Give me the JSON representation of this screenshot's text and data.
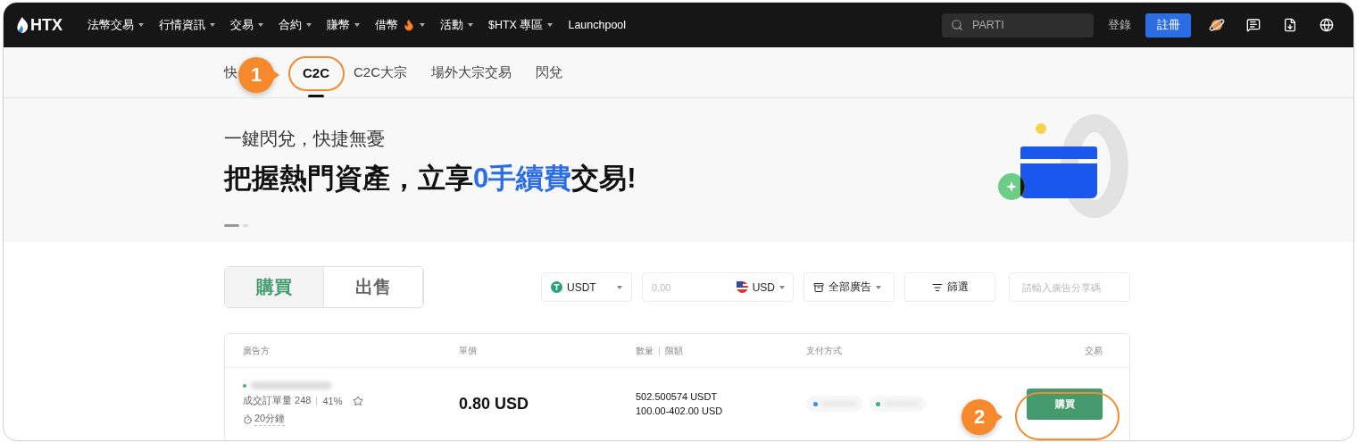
{
  "nav": {
    "logo": "HTX",
    "menu": [
      {
        "label": "法幣交易",
        "dropdown": true,
        "hot": false
      },
      {
        "label": "行情資訊",
        "dropdown": true,
        "hot": false
      },
      {
        "label": "交易",
        "dropdown": true,
        "hot": false
      },
      {
        "label": "合約",
        "dropdown": true,
        "hot": false
      },
      {
        "label": "賺幣",
        "dropdown": true,
        "hot": false
      },
      {
        "label": "借幣",
        "dropdown": true,
        "hot": true
      },
      {
        "label": "活動",
        "dropdown": true,
        "hot": false
      },
      {
        "label": "$HTX 專區",
        "dropdown": true,
        "hot": false
      },
      {
        "label": "Launchpool",
        "dropdown": false,
        "hot": false
      }
    ],
    "search": {
      "value": "PARTI"
    },
    "login": "登錄",
    "register": "註冊"
  },
  "subtabs": [
    {
      "label": "快",
      "selected": false
    },
    {
      "label": "C2C",
      "selected": true
    },
    {
      "label": "C2C大宗",
      "selected": false
    },
    {
      "label": "場外大宗交易",
      "selected": false
    },
    {
      "label": "閃兌",
      "selected": false
    }
  ],
  "banner": {
    "subtitle": "一鍵閃兌，快捷無憂",
    "headline": [
      {
        "text": "把握熱門資產，立享",
        "highlight": false
      },
      {
        "text": "0手續費",
        "highlight": true
      },
      {
        "text": "交易!",
        "highlight": false
      }
    ],
    "slides": [
      {
        "selected": true
      },
      {
        "selected": false
      }
    ]
  },
  "side_tabs": [
    {
      "label": "購買",
      "selected": true
    },
    {
      "label": "出售",
      "selected": false
    }
  ],
  "filters": {
    "coin": "USDT",
    "amount": {
      "placeholder": "0.00",
      "currency": "USD"
    },
    "ads": "全部廣告",
    "filter": "篩選",
    "share_code": {
      "placeholder": "請輸入廣告分享碼"
    }
  },
  "table": {
    "columns": [
      "廣告方",
      "單價",
      "數量",
      "限額",
      "支付方式",
      "交易"
    ],
    "rows": [
      {
        "online": true,
        "orders": "成交訂單量 248",
        "rate": "41%",
        "time": "20分鐘",
        "price": "0.80 USD",
        "quantity": "502.500574 USDT",
        "limits": "100.00-402.00 USD",
        "payments": [
          {
            "color": "#3b8cf5"
          },
          {
            "color": "#3cb371"
          }
        ],
        "action": "購買"
      }
    ]
  },
  "annotations": [
    {
      "number": "1"
    },
    {
      "number": "2"
    }
  ]
}
